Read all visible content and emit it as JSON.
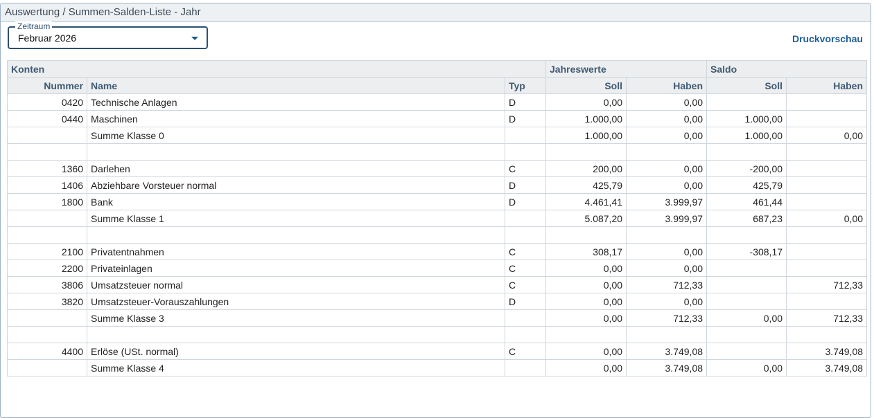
{
  "header": {
    "title": "Auswertung / Summen-Salden-Liste - Jahr"
  },
  "period": {
    "legend": "Zeitraum",
    "value": "Februar 2026",
    "dropdown_icon": "caret-down-icon"
  },
  "actions": {
    "print_preview": "Druckvorschau"
  },
  "table": {
    "group_headers": {
      "accounts": "Konten",
      "annual": "Jahreswerte",
      "balance": "Saldo"
    },
    "columns": {
      "number": "Nummer",
      "name": "Name",
      "type": "Typ",
      "annual_debit": "Soll",
      "annual_credit": "Haben",
      "balance_debit": "Soll",
      "balance_credit": "Haben"
    },
    "rows": [
      {
        "number": "0420",
        "name": "Technische Anlagen",
        "type": "D",
        "annual_debit": "0,00",
        "annual_credit": "0,00",
        "balance_debit": "",
        "balance_credit": ""
      },
      {
        "number": "0440",
        "name": "Maschinen",
        "type": "D",
        "annual_debit": "1.000,00",
        "annual_credit": "0,00",
        "balance_debit": "1.000,00",
        "balance_credit": ""
      },
      {
        "number": "",
        "name": "Summe Klasse 0",
        "type": "",
        "annual_debit": "1.000,00",
        "annual_credit": "0,00",
        "balance_debit": "1.000,00",
        "balance_credit": "0,00"
      },
      {
        "number": "",
        "name": "",
        "type": "",
        "annual_debit": "",
        "annual_credit": "",
        "balance_debit": "",
        "balance_credit": ""
      },
      {
        "number": "1360",
        "name": "Darlehen",
        "type": "C",
        "annual_debit": "200,00",
        "annual_credit": "0,00",
        "balance_debit": "-200,00",
        "balance_credit": ""
      },
      {
        "number": "1406",
        "name": "Abziehbare Vorsteuer normal",
        "type": "D",
        "annual_debit": "425,79",
        "annual_credit": "0,00",
        "balance_debit": "425,79",
        "balance_credit": ""
      },
      {
        "number": "1800",
        "name": "Bank",
        "type": "D",
        "annual_debit": "4.461,41",
        "annual_credit": "3.999,97",
        "balance_debit": "461,44",
        "balance_credit": ""
      },
      {
        "number": "",
        "name": "Summe Klasse 1",
        "type": "",
        "annual_debit": "5.087,20",
        "annual_credit": "3.999,97",
        "balance_debit": "687,23",
        "balance_credit": "0,00"
      },
      {
        "number": "",
        "name": "",
        "type": "",
        "annual_debit": "",
        "annual_credit": "",
        "balance_debit": "",
        "balance_credit": ""
      },
      {
        "number": "2100",
        "name": "Privatentnahmen",
        "type": "C",
        "annual_debit": "308,17",
        "annual_credit": "0,00",
        "balance_debit": "-308,17",
        "balance_credit": ""
      },
      {
        "number": "2200",
        "name": "Privateinlagen",
        "type": "C",
        "annual_debit": "0,00",
        "annual_credit": "0,00",
        "balance_debit": "",
        "balance_credit": ""
      },
      {
        "number": "3806",
        "name": "Umsatzsteuer normal",
        "type": "C",
        "annual_debit": "0,00",
        "annual_credit": "712,33",
        "balance_debit": "",
        "balance_credit": "712,33"
      },
      {
        "number": "3820",
        "name": "Umsatzsteuer-Vorauszahlungen",
        "type": "D",
        "annual_debit": "0,00",
        "annual_credit": "0,00",
        "balance_debit": "",
        "balance_credit": ""
      },
      {
        "number": "",
        "name": "Summe Klasse 3",
        "type": "",
        "annual_debit": "0,00",
        "annual_credit": "712,33",
        "balance_debit": "0,00",
        "balance_credit": "712,33"
      },
      {
        "number": "",
        "name": "",
        "type": "",
        "annual_debit": "",
        "annual_credit": "",
        "balance_debit": "",
        "balance_credit": ""
      },
      {
        "number": "4400",
        "name": "Erlöse (USt. normal)",
        "type": "C",
        "annual_debit": "0,00",
        "annual_credit": "3.749,08",
        "balance_debit": "",
        "balance_credit": "3.749,08"
      },
      {
        "number": "",
        "name": "Summe Klasse 4",
        "type": "",
        "annual_debit": "0,00",
        "annual_credit": "3.749,08",
        "balance_debit": "0,00",
        "balance_credit": "3.749,08"
      }
    ]
  }
}
